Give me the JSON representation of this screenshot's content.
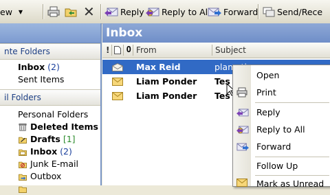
{
  "toolbar": {
    "view_label": "ew",
    "reply_label": "Reply",
    "reply_all_label": "Reply to All",
    "forward_label": "Forward",
    "send_receive_label": "Send/Rece"
  },
  "nav": {
    "favorites_header": "nte Folders",
    "favorites": [
      {
        "label": "Inbox",
        "count": "(2)",
        "bold": true
      },
      {
        "label": "Sent Items",
        "count": "",
        "bold": false
      }
    ],
    "mail_header": "il Folders",
    "mail_folders": [
      {
        "label": "Personal Folders",
        "count": "",
        "bold": false,
        "icon": "personal-folders-icon"
      },
      {
        "label": "Deleted Items",
        "count": "",
        "bold": true,
        "icon": "deleted-items-icon"
      },
      {
        "label": "Drafts",
        "count": "[1]",
        "bold": true,
        "icon": "drafts-icon"
      },
      {
        "label": "Inbox",
        "count": "(2)",
        "bold": true,
        "icon": "inbox-folder-icon"
      },
      {
        "label": "Junk E-mail",
        "count": "",
        "bold": false,
        "icon": "junk-email-icon"
      },
      {
        "label": "Outbox",
        "count": "",
        "bold": false,
        "icon": "outbox-icon"
      }
    ]
  },
  "inbox": {
    "title": "Inbox",
    "columns": {
      "importance": "!",
      "from": "From",
      "subject": "Subject"
    },
    "messages": [
      {
        "from": "Max Reid",
        "subject": "plane tic",
        "selected": true
      },
      {
        "from": "Liam Ponder",
        "subject": "Tes",
        "selected": false
      },
      {
        "from": "Liam Ponder",
        "subject": "Tes",
        "selected": false
      }
    ]
  },
  "context_menu": {
    "items": [
      "Open",
      "Print",
      "Reply",
      "Reply to All",
      "Forward",
      "Follow Up",
      "Mark as Unread"
    ]
  },
  "colors": {
    "selection": "#316ac5",
    "header_blue": "#7d9bd0",
    "unread_count": "#1a3f9c"
  }
}
